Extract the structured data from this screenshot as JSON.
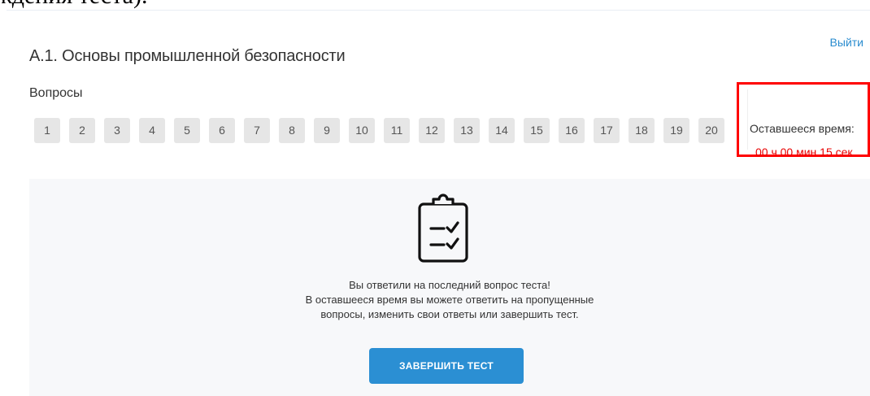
{
  "top_fragment": "ждения теста).",
  "header": {
    "title": "А.1. Основы промышленной безопасности",
    "logout_label": "Выйти"
  },
  "questions": {
    "label": "Вопросы",
    "items": [
      "1",
      "2",
      "3",
      "4",
      "5",
      "6",
      "7",
      "8",
      "9",
      "10",
      "11",
      "12",
      "13",
      "14",
      "15",
      "16",
      "17",
      "18",
      "19",
      "20"
    ]
  },
  "timer": {
    "label": "Оставшееся время:",
    "value": "00 ч 00 мин 15 сек",
    "highlight_color": "#ff0000",
    "value_color": "#e80000"
  },
  "result": {
    "icon": "clipboard-checklist-icon",
    "lines": [
      "Вы ответили на последний вопрос теста!",
      "В оставшееся время вы можете ответить на пропущенные",
      "вопросы, изменить свои ответы или завершить тест."
    ],
    "finish_label": "ЗАВЕРШИТЬ ТЕСТ"
  },
  "colors": {
    "accent": "#2b8fd3",
    "link": "#2a8ccf",
    "question_button_bg": "#e6e6e6",
    "panel_bg": "#f7f8fa"
  }
}
